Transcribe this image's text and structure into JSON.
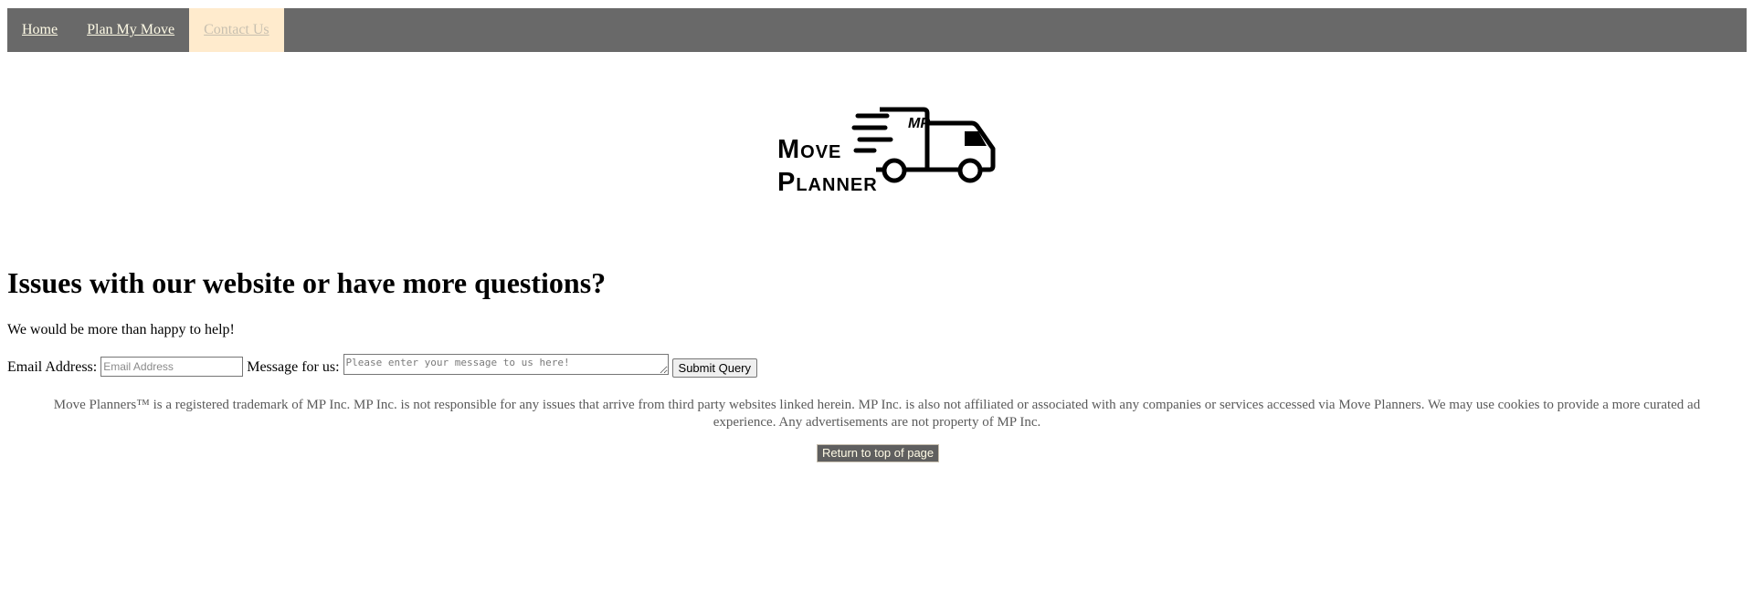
{
  "nav": {
    "items": [
      {
        "label": "Home",
        "active": false
      },
      {
        "label": "Plan My Move",
        "active": false
      },
      {
        "label": "Contact Us",
        "active": true
      }
    ]
  },
  "logo": {
    "line1": "Move",
    "line2": "Planner",
    "truck_text": "MP"
  },
  "main": {
    "heading": "Issues with our website or have more questions?",
    "subtext": "We would be more than happy to help!"
  },
  "form": {
    "email_label": "Email Address:",
    "email_placeholder": "Email Address",
    "message_label": "Message for us:",
    "message_placeholder": "Please enter your message to us here!",
    "submit_label": "Submit Query"
  },
  "footer": {
    "text": "Move Planners™ is a registered trademark of MP Inc. MP Inc. is not responsible for any issues that arrive from third party websites linked herein. MP Inc. is also not affiliated or associated with any companies or services accessed via Move Planners. We may use cookies to provide a more curated ad experience. Any advertisements are not property of MP Inc.",
    "top_button_label": "Return to top of page"
  },
  "colors": {
    "nav_bg": "#696969",
    "nav_active_bg": "#ffebcd",
    "nav_text": "#fffbe6"
  }
}
